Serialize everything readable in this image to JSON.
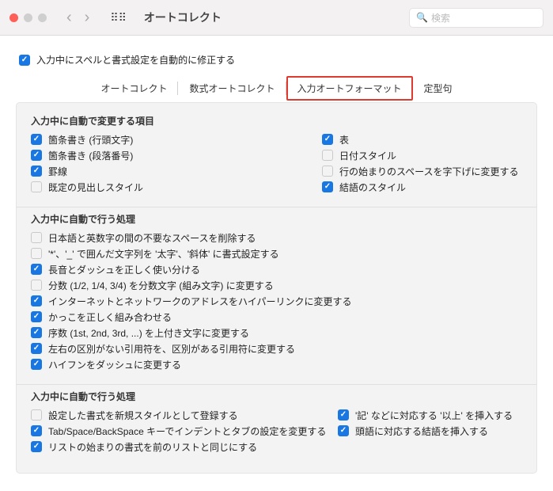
{
  "titlebar": {
    "title": "オートコレクト",
    "search_placeholder": "検索"
  },
  "master_checkbox_label": "入力中にスペルと書式設定を自動的に修正する",
  "tabs": {
    "t0": "オートコレクト",
    "t1": "数式オートコレクト",
    "t2": "入力オートフォーマット",
    "t3": "定型句"
  },
  "section1": {
    "title": "入力中に自動で変更する項目",
    "left": {
      "o0": "箇条書き (行頭文字)",
      "o1": "箇条書き (段落番号)",
      "o2": "罫線",
      "o3": "既定の見出しスタイル"
    },
    "right": {
      "o0": "表",
      "o1": "日付スタイル",
      "o2": "行の始まりのスペースを字下げに変更する",
      "o3": "結語のスタイル"
    }
  },
  "section2": {
    "title": "入力中に自動で行う処理",
    "o0": "日本語と英数字の間の不要なスペースを削除する",
    "o1": "'*'、'_' で囲んだ文字列を '太字'、'斜体' に書式設定する",
    "o2": "長音とダッシュを正しく使い分ける",
    "o3": "分数 (1/2, 1/4, 3/4) を分数文字 (組み文字) に変更する",
    "o4": "インターネットとネットワークのアドレスをハイパーリンクに変更する",
    "o5": "かっこを正しく組み合わせる",
    "o6": "序数 (1st, 2nd, 3rd, ...) を上付き文字に変更する",
    "o7": "左右の区別がない引用符を、区別がある引用符に変更する",
    "o8": "ハイフンをダッシュに変更する"
  },
  "section3": {
    "title": "入力中に自動で行う処理",
    "left": {
      "o0": "設定した書式を新規スタイルとして登録する",
      "o1": "Tab/Space/BackSpace キーでインデントとタブの設定を変更する",
      "o2": "リストの始まりの書式を前のリストと同じにする"
    },
    "right": {
      "o0": "'記' などに対応する '以上' を挿入する",
      "o1": "頭語に対応する結語を挿入する"
    }
  }
}
